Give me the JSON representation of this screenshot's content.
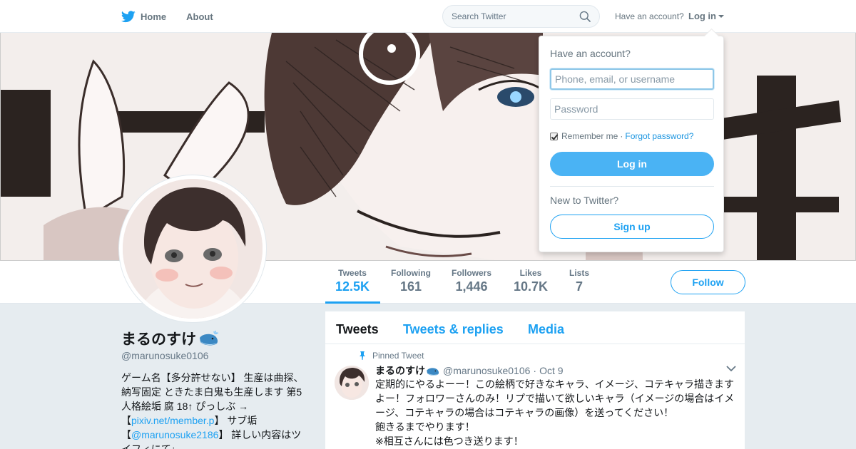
{
  "nav": {
    "home_label": "Home",
    "about_label": "About",
    "search_placeholder": "Search Twitter",
    "have_account": "Have an account?",
    "login_label": "Log in",
    "brand_color": "#1da1f2"
  },
  "profile": {
    "name": "まるのすけ",
    "name_emoji_icon": "whale-icon",
    "handle": "@marunosuke0106",
    "bio_text_1": "ゲーム名【多分許せない】 生産は曲探、納写固定 ときたま白鬼も生産します 第5人格絵垢 腐 18↑ ぴっしぶ →【",
    "bio_link_1": "pixiv.net/member.p",
    "bio_text_2": "】 サブ垢【",
    "bio_link_2": "@marunosuke2186",
    "bio_text_3": "】 詳しい内容はツイフィにて↓"
  },
  "stats": [
    {
      "label": "Tweets",
      "value": "12.5K",
      "active": true
    },
    {
      "label": "Following",
      "value": "161"
    },
    {
      "label": "Followers",
      "value": "1,446"
    },
    {
      "label": "Likes",
      "value": "10.7K"
    },
    {
      "label": "Lists",
      "value": "7"
    }
  ],
  "follow_label": "Follow",
  "timeline": {
    "tabs": [
      "Tweets",
      "Tweets & replies",
      "Media"
    ],
    "pinned_label": "Pinned Tweet",
    "tweet": {
      "name": "まるのすけ",
      "handle": "@marunosuke0106",
      "dot": "·",
      "time": "Oct 9",
      "line1": "定期的にやるよーー！この絵柄で好きなキャラ、イメージ、コテキャラ描きますよー！フォロワーさんのみ！リプで描いて欲しいキャラ（イメージの場合はイメージ、コテキャラの場合はコテキャラの画像）を送ってください！",
      "line2": "飽きるまでやります！",
      "line3": "※相互さんには色つき送ります！"
    }
  },
  "login_dropdown": {
    "title": "Have an account?",
    "username_placeholder": "Phone, email, or username",
    "password_placeholder": "Password",
    "remember_label": "Remember me",
    "separator": "·",
    "forgot_label": "Forgot password?",
    "login_button": "Log in",
    "new_label": "New to Twitter?",
    "signup_button": "Sign up"
  }
}
